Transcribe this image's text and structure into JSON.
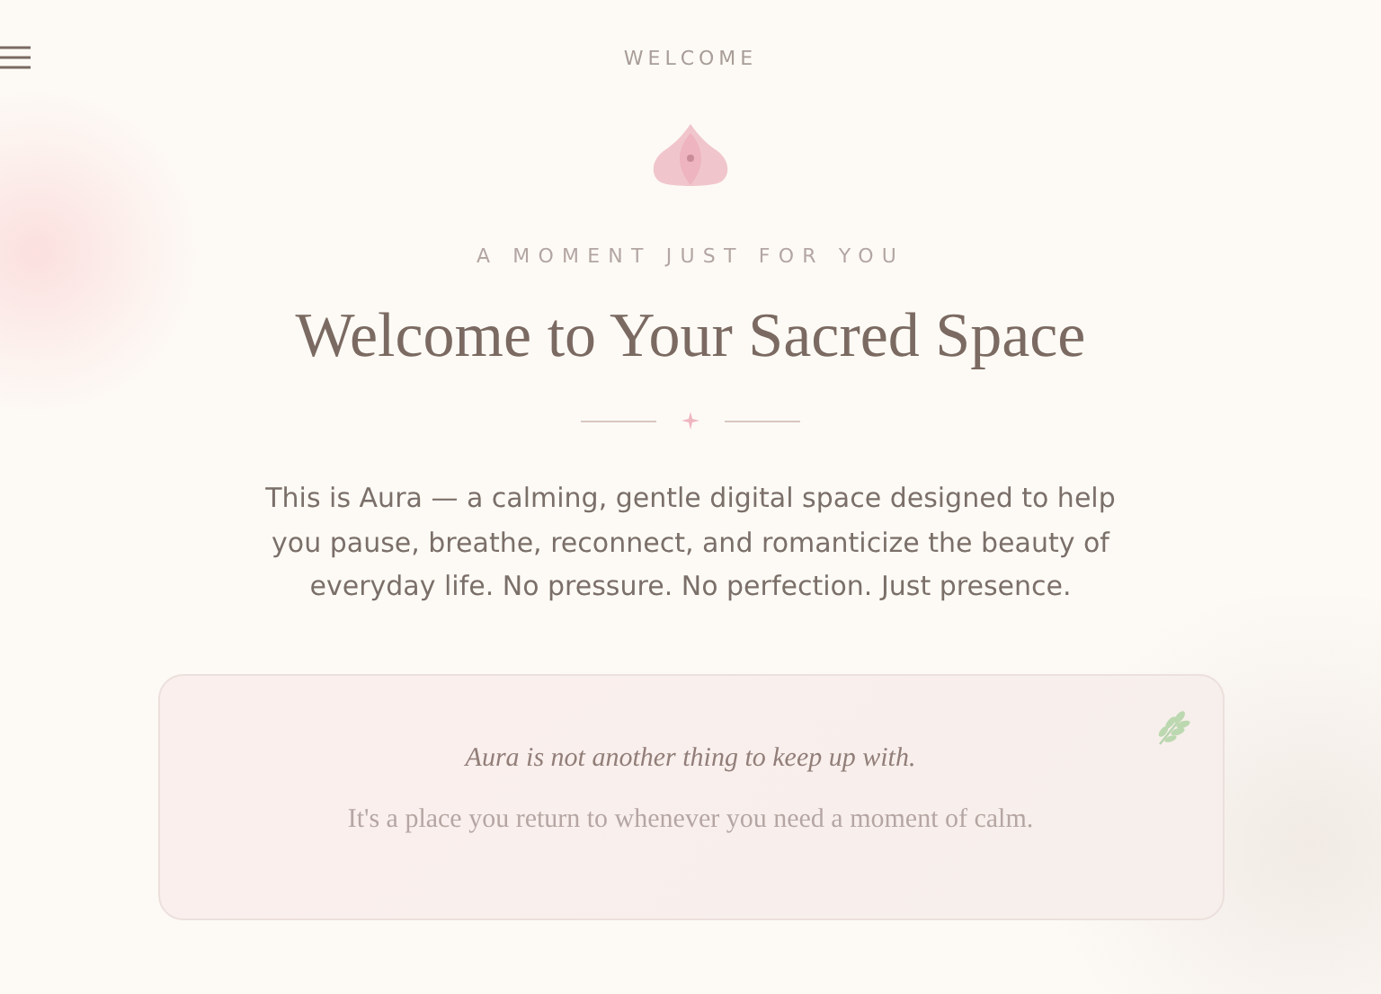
{
  "header": {
    "title": "WELCOME"
  },
  "hero": {
    "eyebrow": "A MOMENT JUST FOR YOU",
    "heading": "Welcome to Your Sacred Space",
    "intro": "This is Aura — a calming, gentle digital space designed to help you pause, breathe, reconnect, and romanticize the beauty of everyday life. No pressure. No perfection. Just presence."
  },
  "card": {
    "lines": [
      {
        "kind": "emphasis",
        "text": "Aura is not another thing to keep up with."
      },
      {
        "kind": "plain",
        "text": "It's a place you return to whenever you need a moment of calm."
      }
    ]
  }
}
